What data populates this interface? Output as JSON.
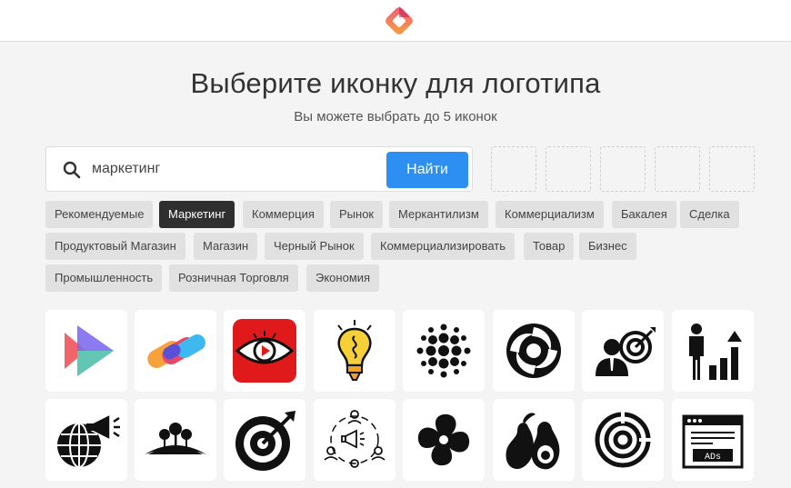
{
  "header": {
    "logo": "app-logo-icon"
  },
  "page": {
    "title": "Выберите иконку для логотипа",
    "subtitle": "Вы можете выбрать до 5 иконок"
  },
  "search": {
    "value": "маркетинг",
    "placeholder": "",
    "button_label": "Найти"
  },
  "selected_slots": 5,
  "tags": [
    {
      "label": "Рекомендуемые",
      "active": false
    },
    {
      "label": "Маркетинг",
      "active": true
    },
    {
      "label": "Коммерция",
      "active": false
    },
    {
      "label": "Рынок",
      "active": false
    },
    {
      "label": "Меркантилизм",
      "active": false
    },
    {
      "label": "Коммерциализм",
      "active": false
    },
    {
      "label": "Бакалея",
      "active": false
    },
    {
      "label": "Сделка",
      "active": false
    },
    {
      "label": "Продуктовый Магазин",
      "active": false
    },
    {
      "label": "Магазин",
      "active": false
    },
    {
      "label": "Черный Рынок",
      "active": false
    },
    {
      "label": "Коммерциализировать",
      "active": false
    },
    {
      "label": "Товар",
      "active": false
    },
    {
      "label": "Бизнес",
      "active": false
    },
    {
      "label": "Промышленность",
      "active": false
    },
    {
      "label": "Розничная Торговля",
      "active": false
    },
    {
      "label": "Экономия",
      "active": false
    }
  ],
  "icons": [
    "play-arrows-icon",
    "colorful-pills-icon",
    "eye-play-icon",
    "lightbulb-icon",
    "dotted-sphere-icon",
    "swirl-icon",
    "businessman-target-icon",
    "businessman-growth-chart-icon",
    "globe-megaphone-icon",
    "tree-hill-icon",
    "target-arrow-icon",
    "team-megaphone-icon",
    "infinity-loop-icon",
    "avocado-icon",
    "bullseye-icon",
    "ads-browser-icon"
  ],
  "colors": {
    "accent": "#2d8ff2",
    "active_tag": "#2f2f2f",
    "tag_bg": "#e1e1e1",
    "page_bg": "#f4f4f4"
  }
}
